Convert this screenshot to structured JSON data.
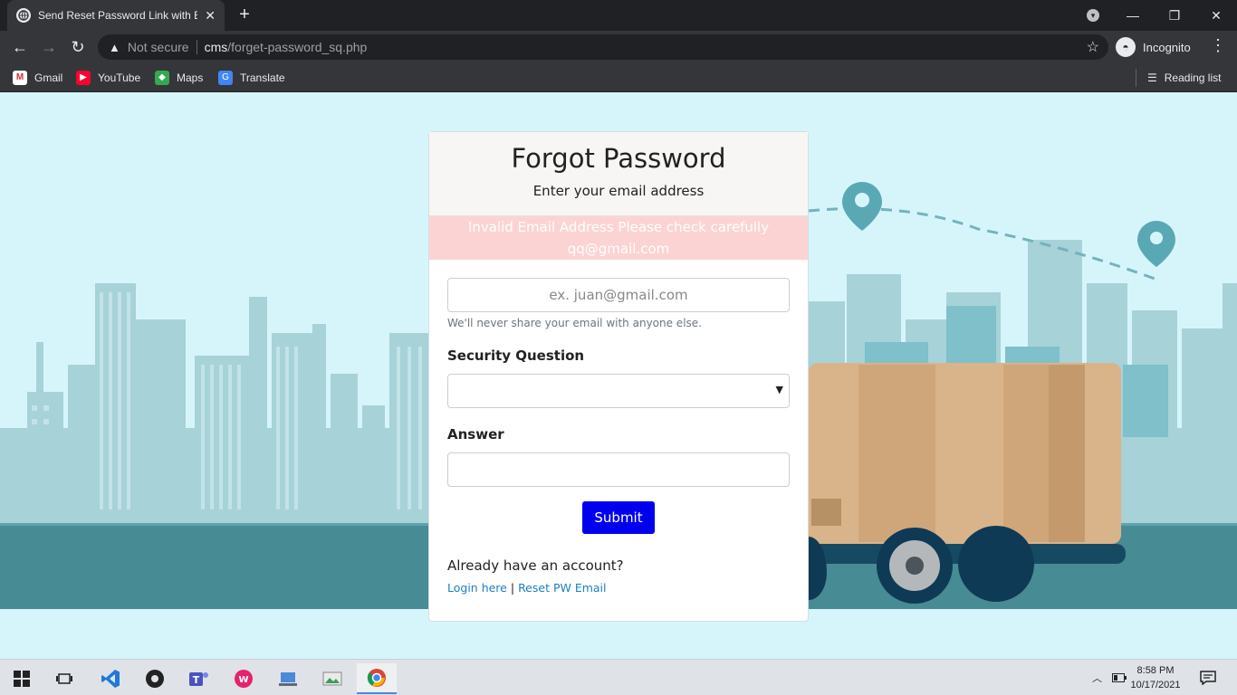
{
  "browser": {
    "tab_title": "Send Reset Password Link with E:",
    "tab_close": "✕",
    "new_tab": "+",
    "url_warning": "Not secure",
    "url_host": "cms",
    "url_path": "/forget-password_sq.php",
    "incognito_label": "Incognito",
    "bookmarks": [
      "Gmail",
      "YouTube",
      "Maps",
      "Translate"
    ],
    "reading_list": "Reading list"
  },
  "card": {
    "title": "Forgot Password",
    "subtitle": "Enter your email address",
    "alert_line1": "Invalid Email Address Please check carefully",
    "alert_line2": "qq@gmail.com",
    "email_placeholder": "ex. juan@gmail.com",
    "email_help": "We'll never share your email with anyone else.",
    "security_label": "Security Question",
    "security_value": "",
    "answer_label": "Answer",
    "answer_value": "",
    "submit_label": "Submit",
    "already_text": "Already have an account?",
    "login_link": "Login here",
    "separator": "|",
    "reset_link": "Reset PW Email"
  },
  "taskbar": {
    "time": "8:58 PM",
    "date": "10/17/2021"
  },
  "colors": {
    "page_bg": "#d6f5fb",
    "alert_bg": "#fcd3d3",
    "submit_bg": "#0000ee",
    "link": "#1a7fc2"
  }
}
